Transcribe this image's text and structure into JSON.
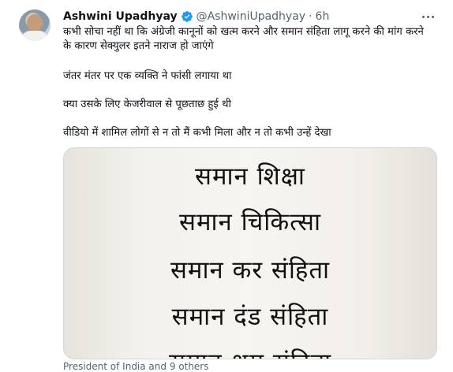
{
  "tweet": {
    "author_name": "Ashwini Upadhyay",
    "handle": "@AshwiniUpadhyay",
    "separator": "·",
    "time": "6h",
    "paragraphs": [
      "कभी सोचा नहीं था कि अंग्रेजी कानूनों को खत्म करने और समान संहिता लागू करने की मांग करने के कारण सेक्युलर इतने नाराज हो जाएंगे",
      "जंतर मंतर पर एक व्यक्ति ने फांसी लगाया था",
      "क्या उसके लिए केजरीवाल से पूछताछ हुई थी",
      "वीडियो में शामिल लोगों से न तो मैं कभी मिला और न तो कभी उन्हें देखा"
    ],
    "media_lines": [
      "समान शिक्षा",
      "समान चिकित्सा",
      "समान कर संहिता",
      "समान दंड संहिता",
      "समान श्रम संहिता"
    ],
    "tagged_caption": "President of India and 9 others"
  },
  "icons": {
    "verified": "verified-badge-icon",
    "more": "more-options-icon"
  },
  "colors": {
    "verified_blue": "#1d9bf0",
    "secondary_text": "#536471",
    "primary_text": "#0f1419"
  }
}
